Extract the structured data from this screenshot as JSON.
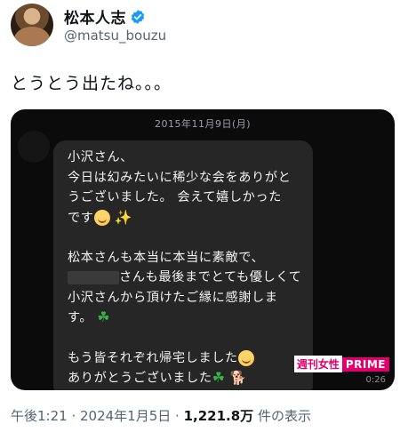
{
  "header": {
    "display_name": "松本人志",
    "handle": "@matsu_bouzu",
    "verified_icon": "verified-badge-icon",
    "verified_color": "#1d9bf0"
  },
  "tweet": {
    "text": "とうとう出たね。。。"
  },
  "media": {
    "date_label": "2015年11月9日(月)",
    "message": {
      "p1_line1": "小沢さん、",
      "p1_line2": "今日は幻みたいに稀少な会をありがと",
      "p1_line3": "うございました。 会えて嬉しかった",
      "p1_line4": "です",
      "p2_line1": "松本さんも本当に本当に素敵で、",
      "p2_line2": "さんも最後までとても優しくて",
      "p2_line3": "小沢さんから頂けたご縁に感謝しま",
      "p2_line4": "す。",
      "p3_line1": "もう皆それぞれ帰宅しました",
      "p3_line2": "ありがとうございました"
    },
    "watermark_left": "週刊女性",
    "watermark_right": "PRIME",
    "duration": "0:26"
  },
  "footer": {
    "time": "午後1:21",
    "sep1": " · ",
    "date": "2024年1月5日",
    "sep2": " · ",
    "view_count": "1,221.8万",
    "views_label": " 件の表示"
  },
  "colors": {
    "watermark_pink": "#e0006b",
    "text_secondary": "#536471"
  }
}
